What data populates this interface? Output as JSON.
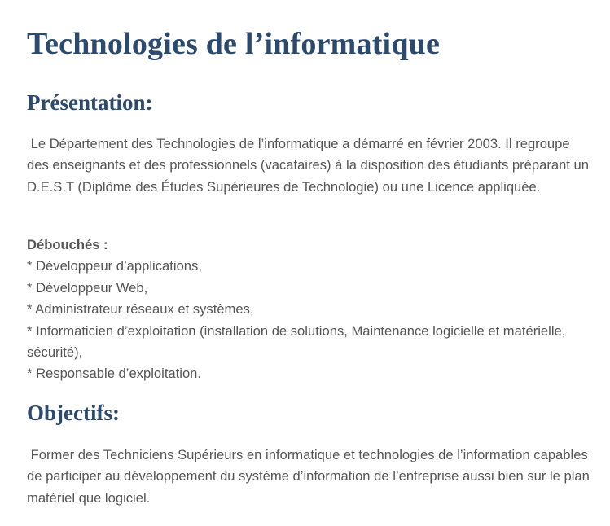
{
  "title": "Technologies de l’informatique",
  "presentation": {
    "heading": "Présentation:",
    "text": " Le Département des Technologies de l’informatique a démarré en février 2003. Il regroupe des enseignants et des professionnels (vacataires) à la disposition des étudiants préparant un D.E.S.T (Diplôme des Études Supérieures de Technologie) ou une Licence appliquée."
  },
  "debouches": {
    "label": "Débouchés :",
    "items": [
      "* Développeur d’applications,",
      "* Développeur Web,",
      "* Administrateur réseaux et systèmes,",
      "* Informaticien d’exploitation (installation de solutions, Maintenance logicielle et matérielle, sécurité),",
      "* Responsable d’exploitation."
    ]
  },
  "objectifs": {
    "heading": "Objectifs:",
    "text": " Former des Techniciens Supérieurs en informatique et technologies de l’information capables de participer au développement du système d’information de l’entreprise aussi bien sur le plan matériel que logiciel."
  },
  "colors": {
    "heading": "#2c4a6e",
    "body_text": "#555555",
    "background": "#ffffff"
  }
}
